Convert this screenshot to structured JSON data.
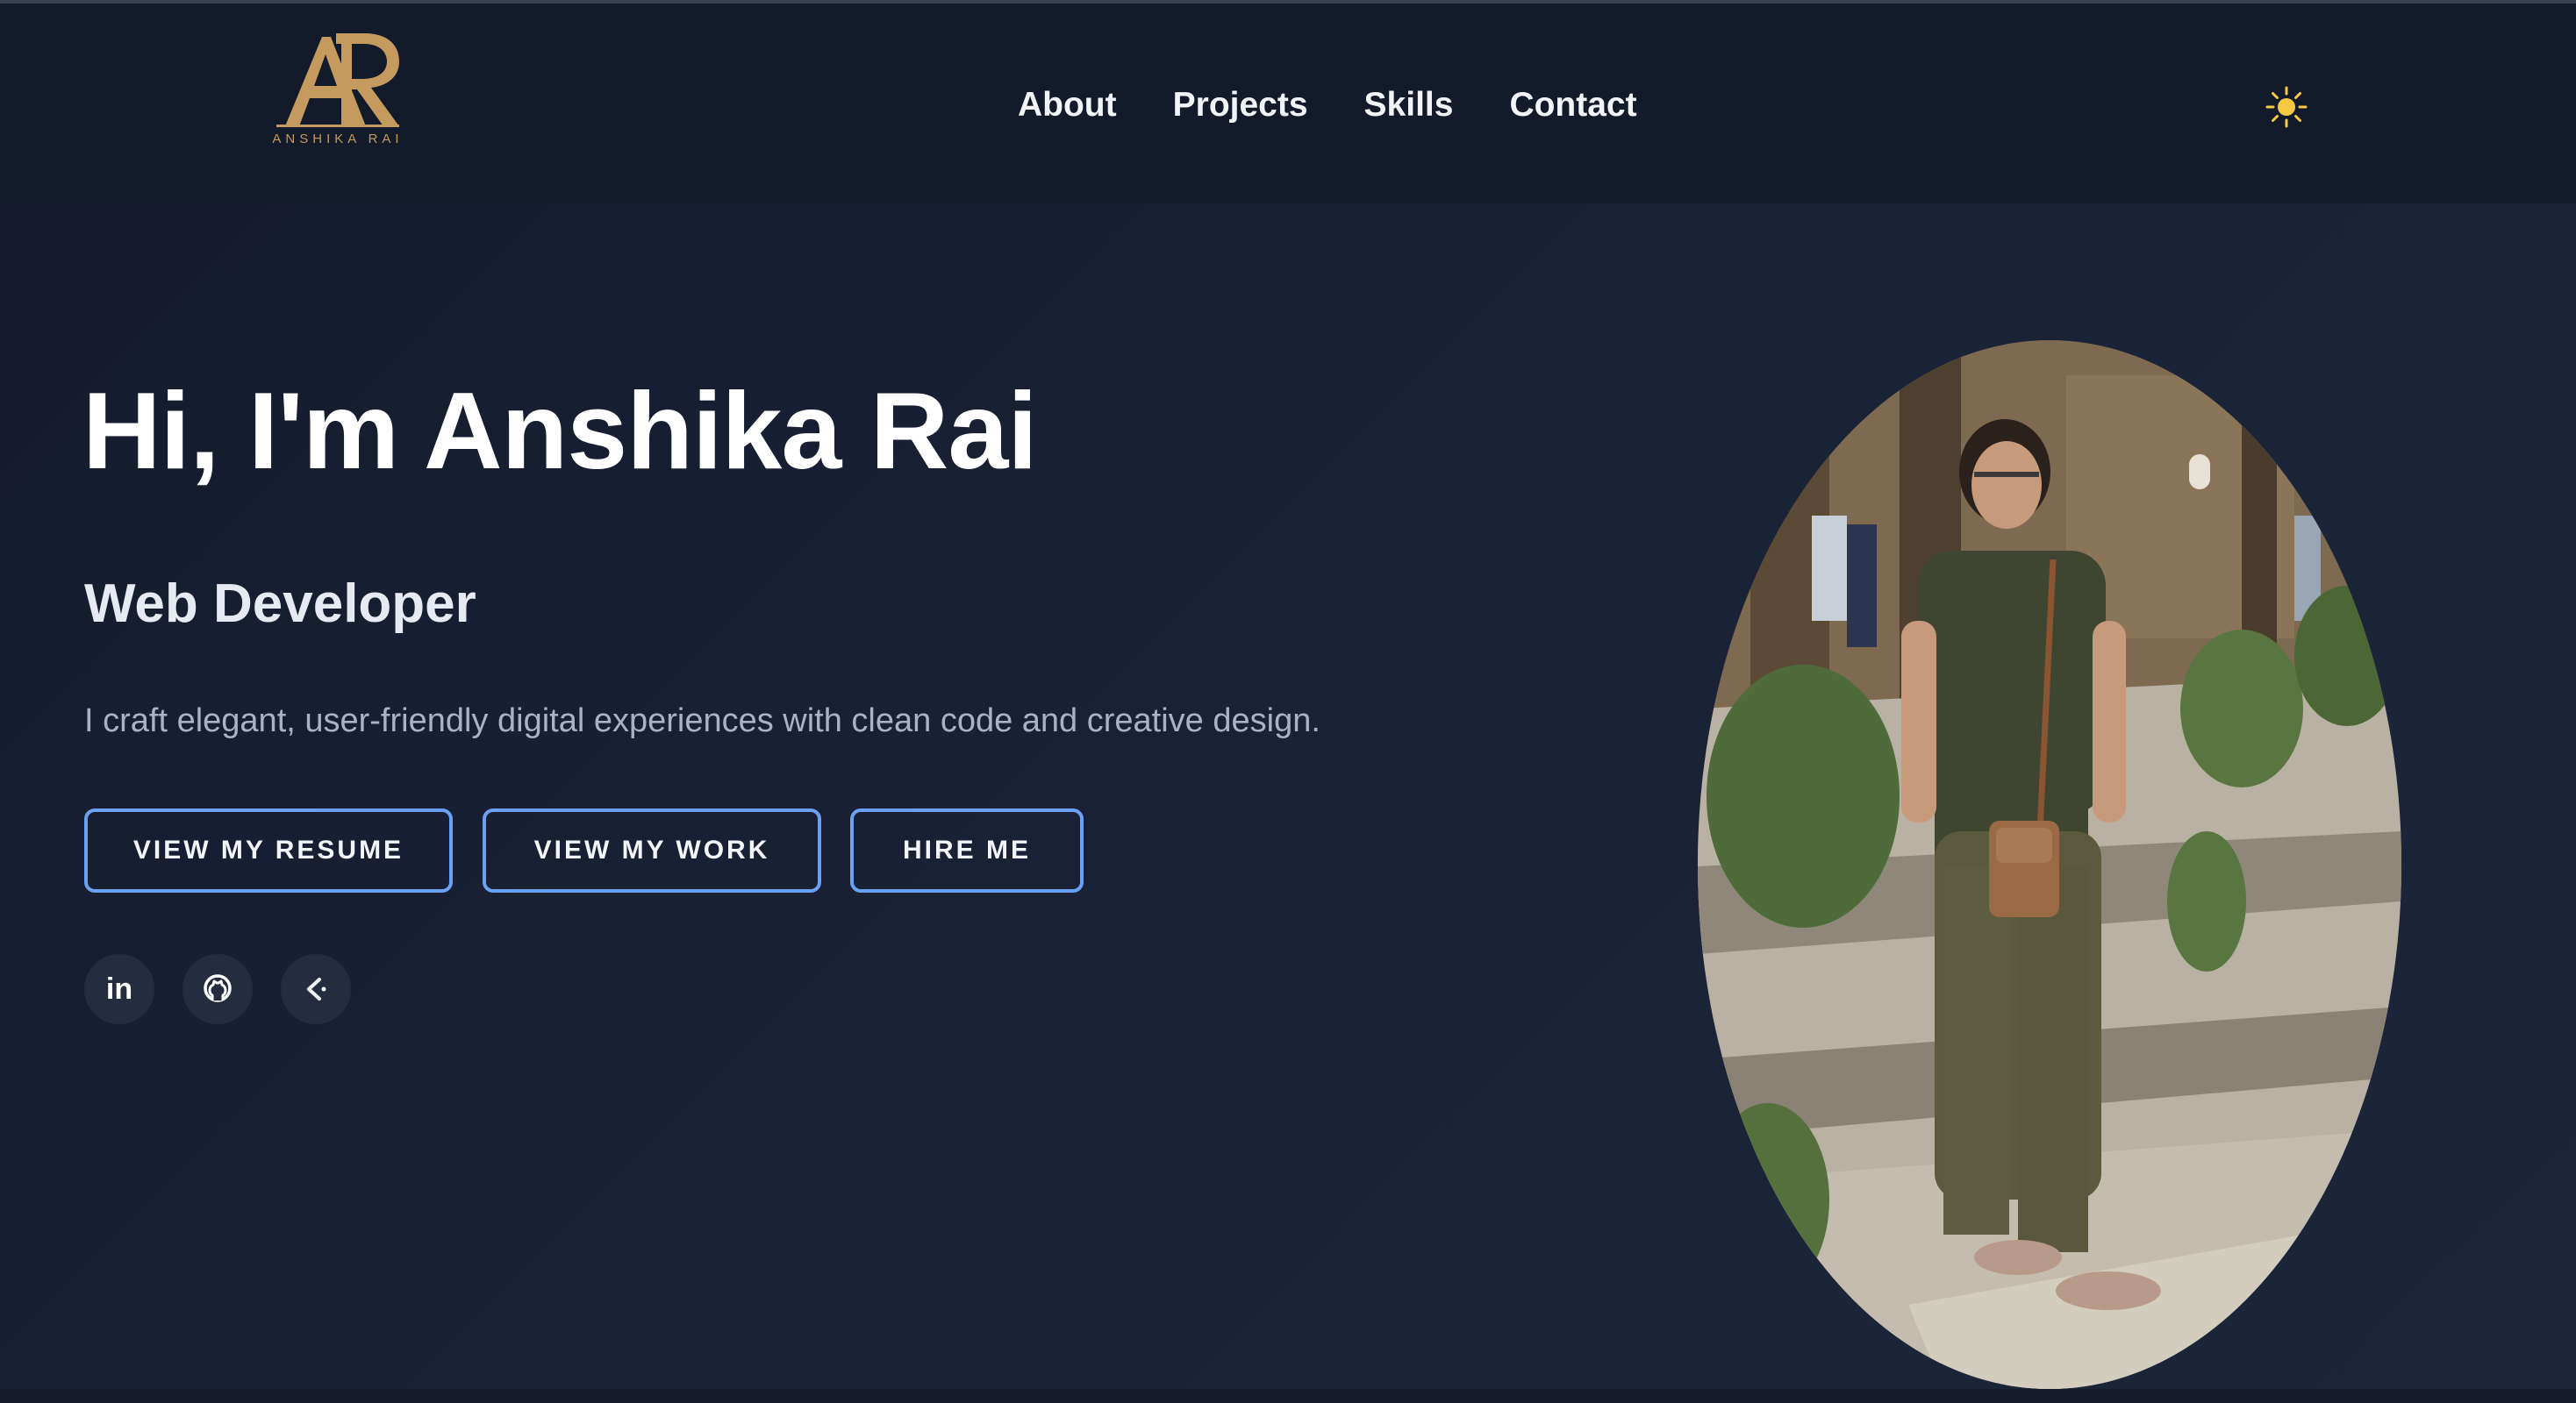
{
  "header": {
    "logo": {
      "monogram": "AR",
      "caption": "ANSHIKA RAI",
      "color": "#c49a5e"
    },
    "nav": [
      {
        "label": "About"
      },
      {
        "label": "Projects"
      },
      {
        "label": "Skills"
      },
      {
        "label": "Contact"
      }
    ],
    "theme_toggle_icon": "sun-icon"
  },
  "hero": {
    "title": "Hi, I'm Anshika Rai",
    "subtitle": "Web Developer",
    "description": "I craft elegant, user-friendly digital experiences with clean code and creative design.",
    "buttons": [
      {
        "label": "VIEW MY RESUME"
      },
      {
        "label": "VIEW MY WORK"
      },
      {
        "label": "HIRE ME"
      }
    ],
    "socials": [
      {
        "label": "in",
        "icon": "linkedin-icon"
      },
      {
        "icon": "github-icon"
      },
      {
        "icon": "portfolio-arrow-icon"
      }
    ],
    "portrait_icon": "profile-photo"
  },
  "colors": {
    "background": "#1a2032",
    "header": "#131a2a",
    "accent_border": "#6aa1f2",
    "text_primary": "#ffffff",
    "text_muted": "#aab3c4",
    "logo_gold": "#c49a5e",
    "sun_yellow": "#f6c945"
  }
}
